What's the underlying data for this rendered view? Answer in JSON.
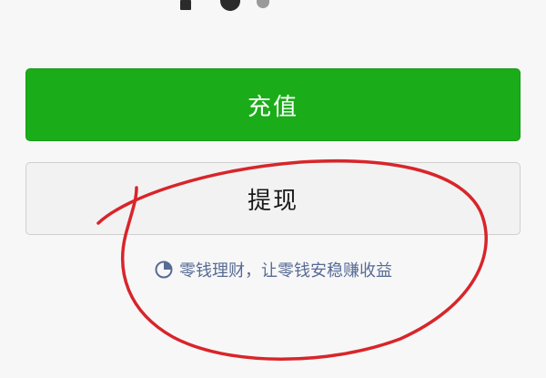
{
  "actions": {
    "recharge_label": "充值",
    "withdraw_label": "提现"
  },
  "licai": {
    "icon": "wealth-management-icon",
    "text": "零钱理财，让零钱安稳赚收益"
  },
  "colors": {
    "primary_green": "#1aad19",
    "secondary_button": "#f2f2f2",
    "link_blue": "#576b95",
    "annotation_red": "#d8252a"
  }
}
